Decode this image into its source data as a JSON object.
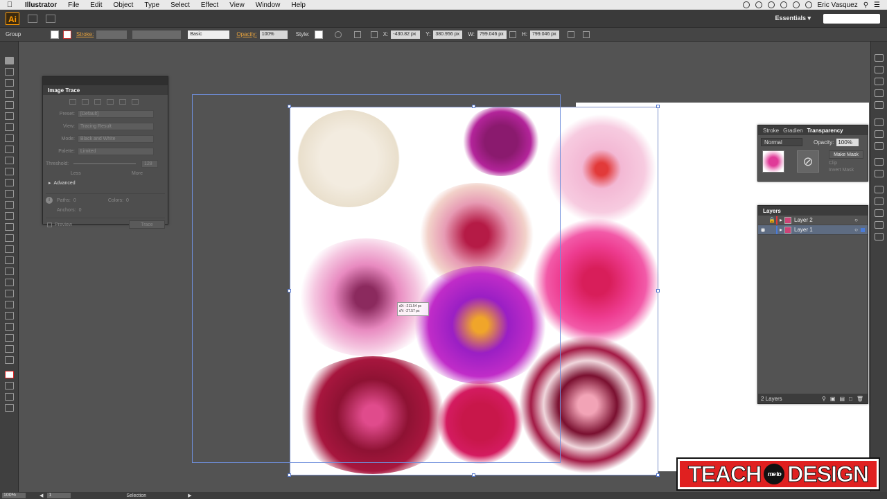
{
  "menubar": {
    "app": "Illustrator",
    "items": [
      "File",
      "Edit",
      "Object",
      "Type",
      "Select",
      "Effect",
      "View",
      "Window",
      "Help"
    ],
    "user": "Eric Vasquez"
  },
  "appbar": {
    "logo": "Ai",
    "workspace": "Essentials ▾"
  },
  "control": {
    "selection_type": "Group",
    "stroke_label": "Stroke:",
    "brush": "Basic",
    "opacity_label": "Opacity:",
    "opacity_value": "100%",
    "style_label": "Style:",
    "x_label": "X:",
    "x_value": "-430.82 px",
    "y_label": "Y:",
    "y_value": "380.956 px",
    "w_label": "W:",
    "w_value": "799.046 px",
    "h_label": "H:",
    "h_value": "799.046 px"
  },
  "image_trace": {
    "title": "Image Trace",
    "preset_label": "Preset:",
    "preset_value": "[Default]",
    "view_label": "View:",
    "view_value": "Tracing Result",
    "mode_label": "Mode:",
    "mode_value": "Black and White",
    "palette_label": "Palette:",
    "palette_value": "Limited",
    "threshold_label": "Threshold:",
    "threshold_value": "128",
    "less": "Less",
    "more": "More",
    "advanced": "Advanced",
    "paths_label": "Paths:",
    "paths_value": "0",
    "colors_label": "Colors:",
    "colors_value": "0",
    "anchors_label": "Anchors:",
    "anchors_value": "0",
    "preview": "Preview",
    "trace_button": "Trace"
  },
  "transparency": {
    "tabs": [
      "Stroke",
      "Gradien",
      "Transparency"
    ],
    "blend_mode": "Normal",
    "opacity_label": "Opacity:",
    "opacity_value": "100%",
    "make_mask": "Make Mask",
    "clip": "Clip",
    "invert_mask": "Invert Mask"
  },
  "layers": {
    "title": "Layers",
    "items": [
      {
        "name": "Layer 2",
        "color": "#e23a3a"
      },
      {
        "name": "Layer 1",
        "color": "#4a7bd8"
      }
    ],
    "count": "2 Layers"
  },
  "canvas": {
    "move_tooltip_dx": "dX: -211.54 px",
    "move_tooltip_dy": "dY: -27.57 px"
  },
  "status": {
    "zoom": "100%",
    "artboard": "1",
    "tool": "Selection"
  },
  "watermark": {
    "left": "TEACH",
    "middle": "me to",
    "right": "DESIGN"
  },
  "colors": {
    "accent": "#e8a33d",
    "trace_lines": "#6f8fdc",
    "layer_selected": "#5e6c82"
  }
}
